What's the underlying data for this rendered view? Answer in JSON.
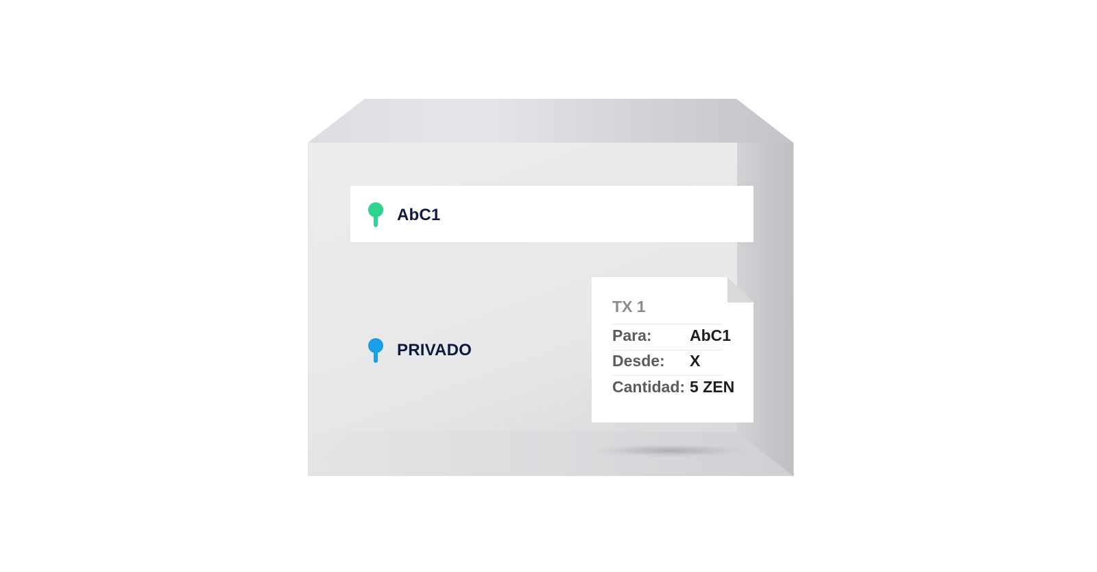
{
  "recipient": {
    "label": "AbC1",
    "pin_color": "#2ed38d"
  },
  "private": {
    "label": "PRIVADO",
    "pin_color": "#1a9ee6"
  },
  "transaction": {
    "title": "TX 1",
    "rows": [
      {
        "key": "Para:",
        "value": "AbC1"
      },
      {
        "key": "Desde:",
        "value": "X"
      },
      {
        "key": "Cantidad:",
        "value": "5 ZEN"
      }
    ]
  }
}
